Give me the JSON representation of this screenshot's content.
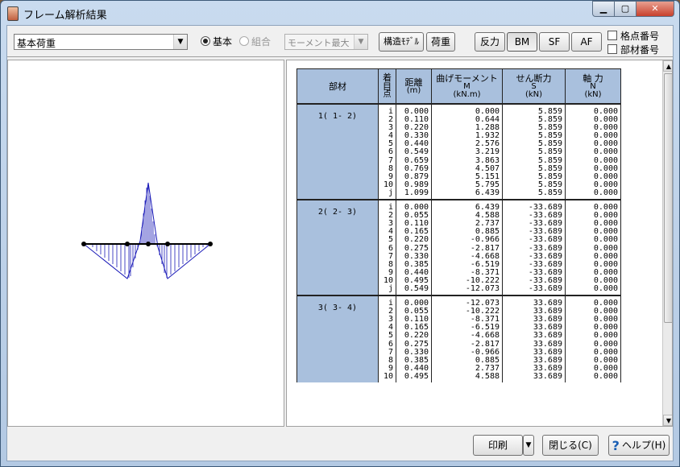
{
  "window": {
    "title": "フレーム解析結果",
    "min_glyph": "▁",
    "max_glyph": "▢",
    "close_glyph": "✕"
  },
  "toolbar": {
    "load_case": "基本荷重",
    "radio_basic": "基本",
    "radio_combo": "組合",
    "moment_select": "モーメント最大",
    "structure_model_btn": "構造ﾓﾃﾞﾙ",
    "load_btn": "荷重",
    "reaction_btn": "反力",
    "bm_btn": "BM",
    "sf_btn": "SF",
    "af_btn": "AF",
    "node_number_chk": "格点番号",
    "member_number_chk": "部材番号"
  },
  "table": {
    "headers": {
      "member": "部材",
      "point_l1": "着目",
      "point_l2": "点",
      "dist_l1": "距離",
      "dist_l2": "(m)",
      "moment_l1": "曲げモーメント",
      "moment_l2": "M",
      "moment_l3": "(kN.m)",
      "shear_l1": "せん断力",
      "shear_l2": "S",
      "shear_l3": "(kN)",
      "axial_l1": "軸 力",
      "axial_l2": "N",
      "axial_l3": "(kN)"
    },
    "groups": [
      {
        "member": "1( 1- 2)",
        "points": "i\n2\n3\n4\n5\n6\n7\n8\n9\n10\nj",
        "dist": "0.000\n0.110\n0.220\n0.330\n0.440\n0.549\n0.659\n0.769\n0.879\n0.989\n1.099",
        "moment": "0.000\n0.644\n1.288\n1.932\n2.576\n3.219\n3.863\n4.507\n5.151\n5.795\n6.439",
        "shear": "5.859\n5.859\n5.859\n5.859\n5.859\n5.859\n5.859\n5.859\n5.859\n5.859\n5.859",
        "axial": "0.000\n0.000\n0.000\n0.000\n0.000\n0.000\n0.000\n0.000\n0.000\n0.000\n0.000"
      },
      {
        "member": "2( 2- 3)",
        "points": "i\n2\n3\n4\n5\n6\n7\n8\n9\n10\nj",
        "dist": "0.000\n0.055\n0.110\n0.165\n0.220\n0.275\n0.330\n0.385\n0.440\n0.495\n0.549",
        "moment": "6.439\n4.588\n2.737\n0.885\n-0.966\n-2.817\n-4.668\n-6.519\n-8.371\n-10.222\n-12.073",
        "shear": "-33.689\n-33.689\n-33.689\n-33.689\n-33.689\n-33.689\n-33.689\n-33.689\n-33.689\n-33.689\n-33.689",
        "axial": "0.000\n0.000\n0.000\n0.000\n0.000\n0.000\n0.000\n0.000\n0.000\n0.000\n0.000"
      },
      {
        "member": "3( 3- 4)",
        "points": "i\n2\n3\n4\n5\n6\n7\n8\n9\n10",
        "dist": "0.000\n0.055\n0.110\n0.165\n0.220\n0.275\n0.330\n0.385\n0.440\n0.495",
        "moment": "-12.073\n-10.222\n-8.371\n-6.519\n-4.668\n-2.817\n-0.966\n0.885\n2.737\n4.588",
        "shear": "33.689\n33.689\n33.689\n33.689\n33.689\n33.689\n33.689\n33.689\n33.689\n33.689",
        "axial": "0.000\n0.000\n0.000\n0.000\n0.000\n0.000\n0.000\n0.000\n0.000\n0.000"
      }
    ]
  },
  "bottom": {
    "print_btn": "印刷",
    "close_btn": "閉じる(C)",
    "help_btn": "ヘルプ(H)"
  },
  "colors": {
    "diagram_line": "#1a1ab8",
    "member_cell": "#a9c0dd"
  }
}
